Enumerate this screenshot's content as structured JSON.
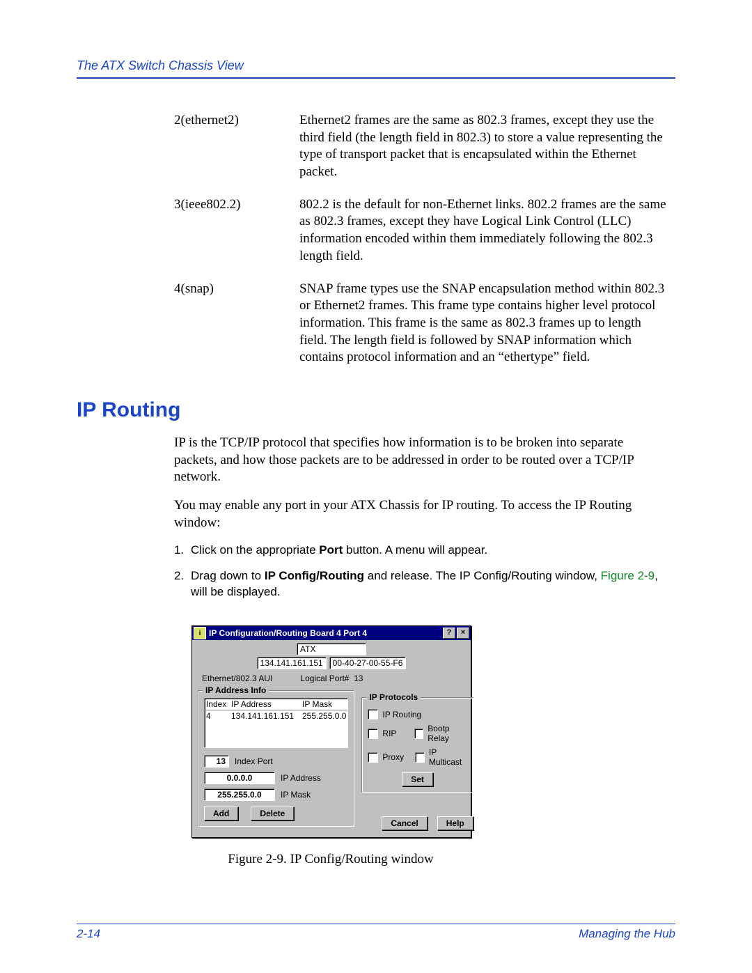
{
  "header": {
    "running": "The ATX Switch Chassis View"
  },
  "defs": [
    {
      "term": "2(ethernet2)",
      "body": "Ethernet2 frames are the same as 802.3 frames, except they use the third field (the length field in 802.3) to store a value representing the type of transport packet that is encapsulated within the Ethernet packet."
    },
    {
      "term": "3(ieee802.2)",
      "body": "802.2 is the default for non-Ethernet links. 802.2 frames are the same as 802.3 frames, except they have Logical Link Control (LLC) information encoded within them immediately following the 802.3 length field."
    },
    {
      "term": "4(snap)",
      "body": "SNAP frame types use the SNAP encapsulation method within 802.3 or Ethernet2 frames. This frame type contains higher level protocol information. This frame is the same as 802.3 frames up to length field. The length field is followed by SNAP information which contains protocol information and an “ethertype” field."
    }
  ],
  "section_title": "IP Routing",
  "para1": "IP is the TCP/IP protocol that specifies how information is to be broken into separate packets, and how those packets are to be addressed in order to be routed over a TCP/IP network.",
  "para2": "You may enable any port in your ATX Chassis for IP routing. To access the IP Routing window:",
  "steps": {
    "s1_a": "Click on the appropriate ",
    "s1_bold": "Port",
    "s1_b": " button. A menu will appear.",
    "s2_a": "Drag down to ",
    "s2_bold": "IP Config/Routing",
    "s2_b": " and release. The IP Config/Routing window, ",
    "s2_link": "Figure 2-9",
    "s2_c": ", will be displayed."
  },
  "dialog": {
    "title": "IP Configuration/Routing Board 4 Port 4",
    "help_glyph": "?",
    "close_glyph": "×",
    "device": "ATX",
    "ip": "134.141.161.151",
    "mac": "00-40-27-00-55-F6",
    "media": "Ethernet/802.3 AUI",
    "logical_label": "Logical Port#",
    "logical_value": "13",
    "grp_addr": "IP Address Info",
    "cols": {
      "idx": "Index",
      "ip": "IP Address",
      "mask": "IP Mask"
    },
    "row": {
      "idx": "4",
      "ip": "134.141.161.151",
      "mask": "255.255.0.0"
    },
    "index_port_val": "13",
    "index_port_lbl": "Index Port",
    "ipaddr_val": "0.0.0.0",
    "ipaddr_lbl": "IP Address",
    "ipmask_val": "255.255.0.0",
    "ipmask_lbl": "IP Mask",
    "btn_add": "Add",
    "btn_delete": "Delete",
    "grp_proto": "IP Protocols",
    "p_routing": "IP Routing",
    "p_rip": "RIP",
    "p_bootp": "Bootp Relay",
    "p_proxy": "Proxy",
    "p_mcast": "IP Multicast",
    "btn_set": "Set",
    "btn_cancel": "Cancel",
    "btn_help": "Help"
  },
  "figure_caption": "Figure 2-9.  IP Config/Routing window",
  "footer": {
    "left": "2-14",
    "right": "Managing the Hub"
  }
}
